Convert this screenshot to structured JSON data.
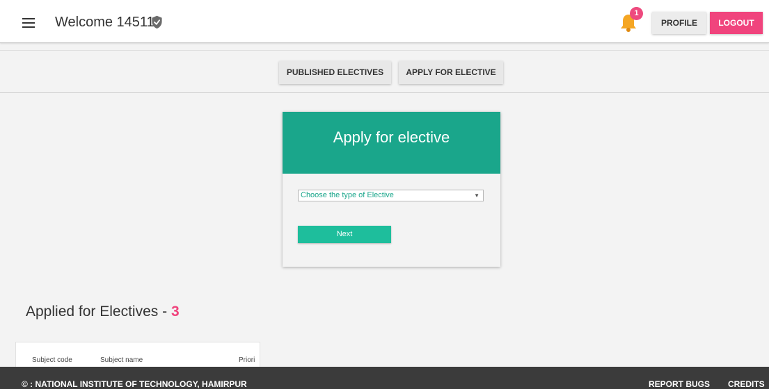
{
  "header": {
    "welcome_text": "Welcome 14511",
    "notification_count": "1",
    "profile_label": "PROFILE",
    "logout_label": "LOGOUT"
  },
  "subnav": {
    "published_label": "PUBLISHED ELECTIVES",
    "apply_label": "APPLY FOR ELECTIVE"
  },
  "card": {
    "title": "Apply for elective",
    "select_value": "Choose the type of Elective",
    "next_label": "Next"
  },
  "applied": {
    "heading": "Applied for Electives - ",
    "count": "3",
    "columns": [
      "Subject code",
      "Subject name",
      "Priori"
    ]
  },
  "footer": {
    "copyright": "© : NATIONAL INSTITUTE OF TECHNOLOGY, HAMIRPUR",
    "report_bugs": "REPORT BUGS",
    "credits": "CREDITS"
  },
  "colors": {
    "accent_teal": "#1aa68b",
    "accent_pink": "#f0447d",
    "footer_bg": "#3b3b3b"
  },
  "icons": [
    "menu-icon",
    "verified-shield-icon",
    "notification-bell-icon",
    "dropdown-arrow-icon"
  ]
}
